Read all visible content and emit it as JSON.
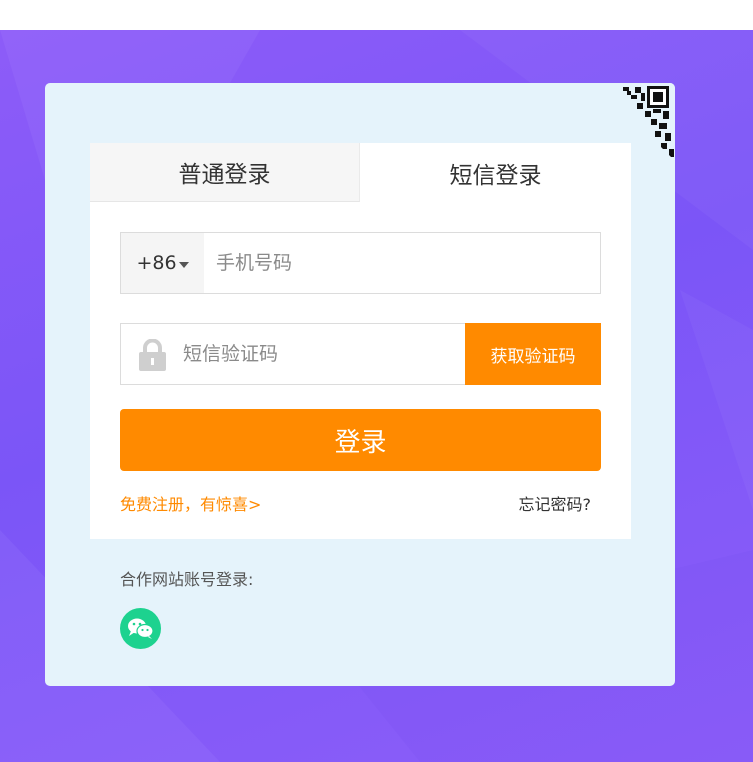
{
  "tabs": [
    {
      "label": "普通登录",
      "active": false
    },
    {
      "label": "短信登录",
      "active": true
    }
  ],
  "phone": {
    "country_code": "+86",
    "placeholder": "手机号码"
  },
  "sms": {
    "placeholder": "短信验证码",
    "get_code_label": "获取验证码"
  },
  "login_label": "登录",
  "register_label": "免费注册，有惊喜>",
  "forgot_label": "忘记密码?",
  "partner_label": "合作网站账号登录:",
  "colors": {
    "accent": "#ff8a00",
    "background": "#8159f7",
    "card": "#e5f3fb",
    "wechat": "#1dd28f"
  },
  "icons": [
    "qr-code-icon",
    "lock-icon",
    "wechat-icon",
    "caret-down-icon"
  ]
}
